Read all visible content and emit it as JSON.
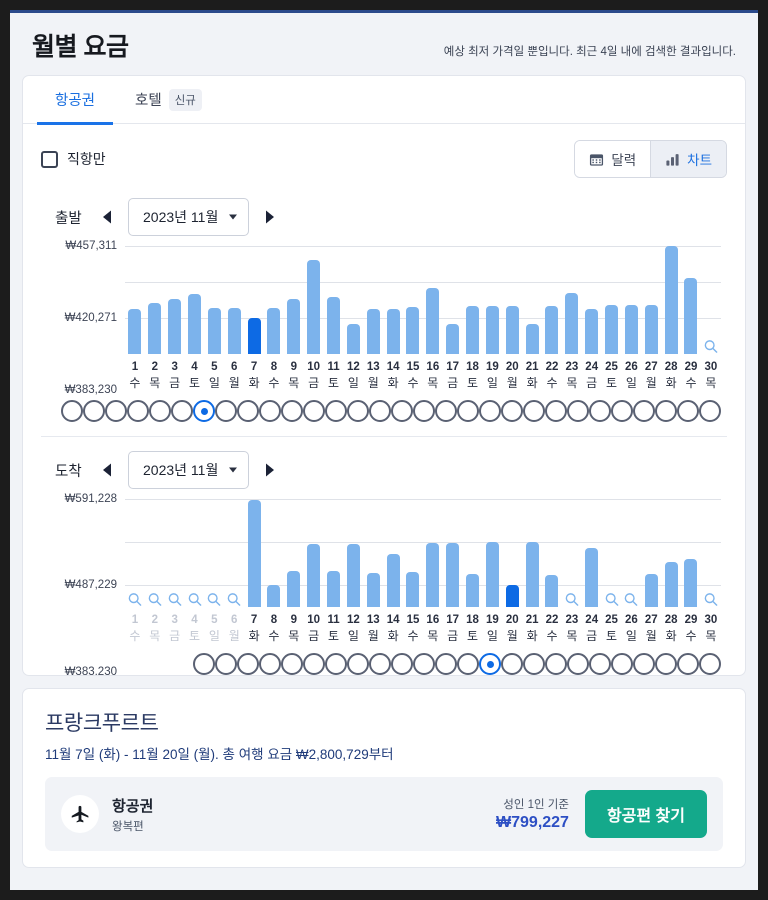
{
  "header": {
    "title": "월별 요금",
    "disclaimer": "예상 최저 가격일 뿐입니다. 최근 4일 내에 검색한 결과입니다."
  },
  "tabs": [
    {
      "label": "항공권",
      "active": true,
      "badge": null
    },
    {
      "label": "호텔",
      "active": false,
      "badge": "신규"
    }
  ],
  "options": {
    "nonstop_label": "직항만",
    "nonstop_checked": false,
    "view_toggle": [
      {
        "label": "달력",
        "icon": "calendar-icon",
        "active": false
      },
      {
        "label": "차트",
        "icon": "bar-chart-icon",
        "active": true
      }
    ]
  },
  "legs": [
    {
      "key": "departure",
      "label": "출발",
      "month_value": "2023년 11월",
      "prev_label": "이전 달",
      "next_label": "다음 달",
      "selected_day": 7,
      "radio_start_day": 1
    },
    {
      "key": "arrival",
      "label": "도착",
      "month_value": "2023년 11월",
      "prev_label": "이전 달",
      "next_label": "다음 달",
      "selected_day": 20,
      "radio_start_day": 7
    }
  ],
  "chart_data": [
    {
      "type": "bar",
      "title": "출발",
      "xlabel": "",
      "ylabel": "",
      "currency": "₩",
      "grid": true,
      "ylim": [
        346190,
        457311
      ],
      "ytick_labels": [
        "₩457,311",
        "₩420,271",
        "₩383,230"
      ],
      "ytick_values": [
        457311,
        420271,
        383230
      ],
      "categories": [
        1,
        2,
        3,
        4,
        5,
        6,
        7,
        8,
        9,
        10,
        11,
        12,
        13,
        14,
        15,
        16,
        17,
        18,
        19,
        20,
        21,
        22,
        23,
        24,
        25,
        26,
        27,
        28,
        29,
        30
      ],
      "dow": [
        "수",
        "목",
        "금",
        "토",
        "일",
        "월",
        "화",
        "수",
        "목",
        "금",
        "토",
        "일",
        "월",
        "화",
        "수",
        "목",
        "금",
        "토",
        "일",
        "월",
        "화",
        "수",
        "목",
        "금",
        "토",
        "일",
        "월",
        "화",
        "수",
        "목"
      ],
      "values": [
        392000,
        399000,
        403000,
        408000,
        394000,
        394000,
        383230,
        394000,
        403000,
        443000,
        405000,
        377000,
        392000,
        392000,
        395000,
        414000,
        377000,
        396000,
        396000,
        396000,
        377000,
        396000,
        409000,
        393000,
        397000,
        397000,
        397000,
        457000,
        424000,
        null
      ],
      "disabled_days": [],
      "selected_day": 7,
      "no_data_days": [
        30
      ],
      "bar_color": "#7cb3ec",
      "selected_bar_color": "#0d6ae4"
    },
    {
      "type": "bar",
      "title": "도착",
      "xlabel": "",
      "ylabel": "",
      "currency": "₩",
      "grid": true,
      "ylim": [
        331231,
        591228
      ],
      "ytick_labels": [
        "₩591,228",
        "₩487,229",
        "₩383,230"
      ],
      "ytick_values": [
        591228,
        487229,
        383230
      ],
      "categories": [
        1,
        2,
        3,
        4,
        5,
        6,
        7,
        8,
        9,
        10,
        11,
        12,
        13,
        14,
        15,
        16,
        17,
        18,
        19,
        20,
        21,
        22,
        23,
        24,
        25,
        26,
        27,
        28,
        29,
        30
      ],
      "dow": [
        "수",
        "목",
        "금",
        "토",
        "일",
        "월",
        "화",
        "수",
        "목",
        "금",
        "토",
        "일",
        "월",
        "화",
        "수",
        "목",
        "금",
        "토",
        "일",
        "월",
        "화",
        "수",
        "목",
        "금",
        "토",
        "일",
        "월",
        "화",
        "수",
        "목"
      ],
      "values": [
        null,
        null,
        null,
        null,
        null,
        null,
        589000,
        384000,
        418000,
        483000,
        418000,
        483000,
        412000,
        460000,
        416000,
        485000,
        485000,
        411000,
        487000,
        383230,
        487000,
        409000,
        null,
        473000,
        null,
        null,
        410000,
        440000,
        446000,
        null
      ],
      "disabled_days": [
        1,
        2,
        3,
        4,
        5,
        6
      ],
      "selected_day": 20,
      "no_data_days": [
        23,
        25,
        26,
        30
      ],
      "bar_color": "#7cb3ec",
      "selected_bar_color": "#0d6ae4"
    }
  ],
  "summary": {
    "destination": "프랑크푸르트",
    "date_range": "11월 7일 (화) - 11월 20일 (월). 총 여행 요금 ₩2,800,729부터",
    "offer": {
      "icon": "airplane-icon",
      "type_label": "항공권",
      "sub_label": "왕복편",
      "price_caption": "성인 1인 기준",
      "price_value": "₩799,227",
      "cta_label": "항공편 찾기"
    }
  },
  "colors": {
    "accent_blue": "#1a73e8",
    "bar_light": "#7cb3ec",
    "bar_selected": "#0d6ae4",
    "cta_green": "#14a98b",
    "page_bg": "#f1f3f7"
  }
}
